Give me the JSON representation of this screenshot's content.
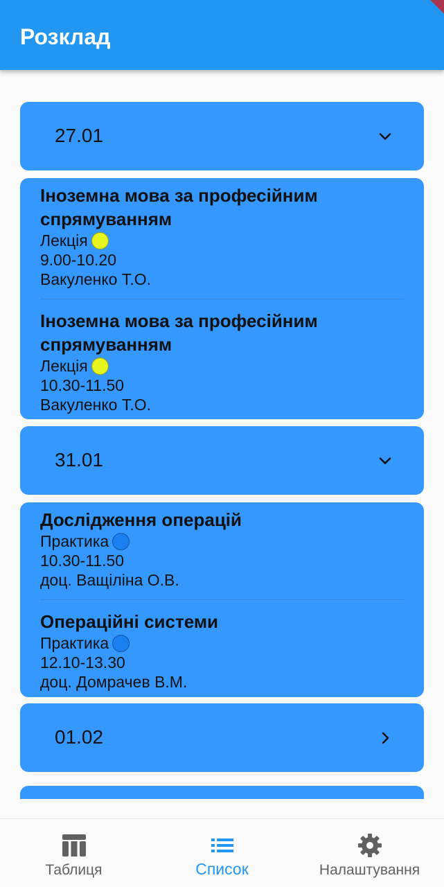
{
  "appbar": {
    "title": "Розклад"
  },
  "schedule": [
    {
      "date": "27.01",
      "expanded": true,
      "lessons": [
        {
          "name_line1": "Іноземна мова за професійним",
          "name_line2": "спрямуванням",
          "type": "Лекція",
          "type_color": "#e7f51f",
          "time": "9.00-10.20",
          "teacher": "Вакуленко Т.О."
        },
        {
          "name_line1": "Іноземна мова за професійним",
          "name_line2": "спрямуванням",
          "type": "Лекція",
          "type_color": "#e7f51f",
          "time": "10.30-11.50",
          "teacher": "Вакуленко Т.О."
        }
      ]
    },
    {
      "date": "31.01",
      "expanded": true,
      "lessons": [
        {
          "name_line1": "Дослідження операцій",
          "type": "Практика",
          "type_color": "#1a7ff0",
          "time": "10.30-11.50",
          "teacher": "доц. Ващіліна О.В."
        },
        {
          "name_line1": "Операційні системи",
          "type": "Практика",
          "type_color": "#1a7ff0",
          "time": "12.10-13.30",
          "teacher": "доц. Домрачев В.М."
        }
      ]
    },
    {
      "date": "01.02",
      "expanded": false,
      "lessons": []
    }
  ],
  "bottom_nav": {
    "items": [
      {
        "label": "Таблиця",
        "icon": "table-icon",
        "active": false
      },
      {
        "label": "Список",
        "icon": "list-icon",
        "active": true
      },
      {
        "label": "Налаштування",
        "icon": "gear-icon",
        "active": false
      }
    ]
  },
  "colors": {
    "primary": "#2196f3",
    "card": "#3598ff",
    "lecture_dot": "#e7f51f",
    "practice_dot": "#1a7ff0",
    "inactive_nav": "#616161"
  }
}
